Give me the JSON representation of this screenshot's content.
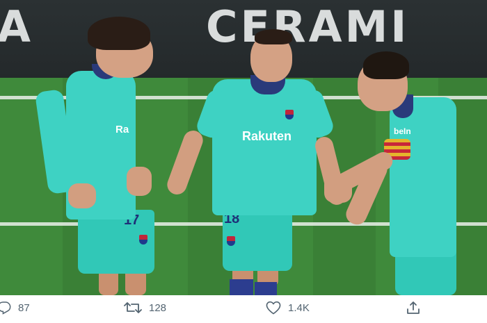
{
  "photo": {
    "ad_text_left": "A",
    "ad_text_right": "CERAMI",
    "sponsor_front": "Rakuten",
    "sponsor_side": "Ra",
    "sponsor_sleeve": "beIn",
    "number_shorts_center": "18",
    "number_shorts_left": "17"
  },
  "actions": {
    "reply_count": "87",
    "retweet_count": "128",
    "like_count": "1.4K"
  },
  "icons": {
    "reply": "reply-icon",
    "retweet": "retweet-icon",
    "like": "heart-icon",
    "share": "share-icon"
  },
  "colors": {
    "kit": "#3ed2c3",
    "action_text": "#536471"
  }
}
